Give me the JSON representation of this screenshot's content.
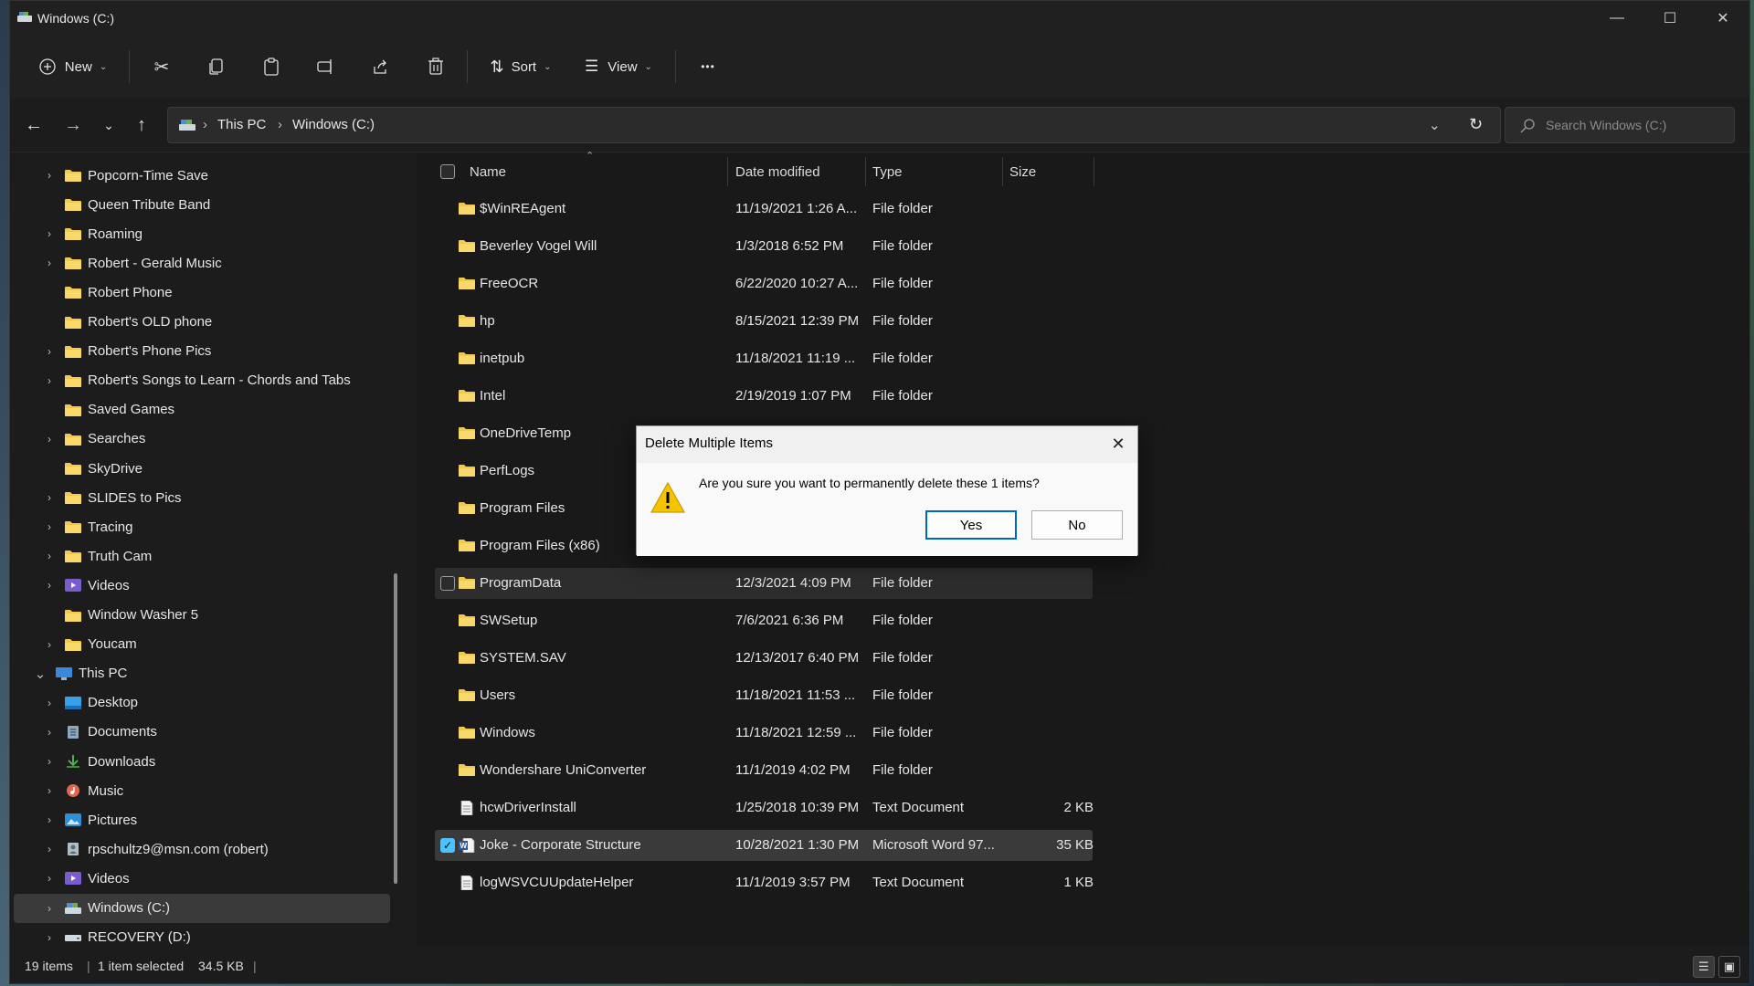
{
  "window": {
    "title": "Windows (C:)"
  },
  "toolbar": {
    "new_label": "New",
    "sort_label": "Sort",
    "view_label": "View",
    "more_label": "•••"
  },
  "address": {
    "crumbs": [
      "This PC",
      "Windows (C:)"
    ],
    "search_placeholder": "Search Windows (C:)"
  },
  "sidebar": {
    "items": [
      {
        "label": "Popcorn-Time Save",
        "expandable": true,
        "icon": "folder-icon"
      },
      {
        "label": "Queen Tribute Band",
        "expandable": false,
        "icon": "folder-icon"
      },
      {
        "label": "Roaming",
        "expandable": true,
        "icon": "folder-icon"
      },
      {
        "label": "Robert - Gerald Music",
        "expandable": true,
        "icon": "folder-icon"
      },
      {
        "label": "Robert Phone",
        "expandable": false,
        "icon": "folder-icon"
      },
      {
        "label": "Robert's OLD phone",
        "expandable": false,
        "icon": "folder-icon"
      },
      {
        "label": "Robert's Phone Pics",
        "expandable": true,
        "icon": "folder-icon"
      },
      {
        "label": "Robert's Songs to Learn - Chords and Tabs",
        "expandable": true,
        "icon": "folder-icon"
      },
      {
        "label": "Saved Games",
        "expandable": false,
        "icon": "folder-icon"
      },
      {
        "label": "Searches",
        "expandable": true,
        "icon": "folder-icon"
      },
      {
        "label": "SkyDrive",
        "expandable": false,
        "icon": "folder-icon"
      },
      {
        "label": "SLIDES to Pics",
        "expandable": true,
        "icon": "folder-icon"
      },
      {
        "label": "Tracing",
        "expandable": true,
        "icon": "folder-icon"
      },
      {
        "label": "Truth Cam",
        "expandable": true,
        "icon": "folder-icon"
      },
      {
        "label": "Videos",
        "expandable": true,
        "icon": "videos-icon"
      },
      {
        "label": "Window Washer 5",
        "expandable": false,
        "icon": "folder-icon"
      },
      {
        "label": "Youcam",
        "expandable": true,
        "icon": "folder-icon"
      },
      {
        "label": "This PC",
        "expandable": true,
        "expanded": true,
        "icon": "pc-icon"
      },
      {
        "label": "Desktop",
        "expandable": true,
        "icon": "desktop-icon"
      },
      {
        "label": "Documents",
        "expandable": true,
        "icon": "documents-icon"
      },
      {
        "label": "Downloads",
        "expandable": true,
        "icon": "downloads-icon"
      },
      {
        "label": "Music",
        "expandable": true,
        "icon": "music-icon"
      },
      {
        "label": "Pictures",
        "expandable": true,
        "icon": "pictures-icon"
      },
      {
        "label": "rpschultz9@msn.com (robert)",
        "expandable": true,
        "icon": "user-folder-icon"
      },
      {
        "label": "Videos",
        "expandable": true,
        "icon": "videos-icon"
      },
      {
        "label": "Windows (C:)",
        "expandable": true,
        "selected": true,
        "icon": "drive-c-icon"
      },
      {
        "label": "RECOVERY (D:)",
        "expandable": true,
        "icon": "drive-icon"
      }
    ]
  },
  "columns": {
    "name": "Name",
    "date": "Date modified",
    "type": "Type",
    "size": "Size"
  },
  "files": [
    {
      "name": "$WinREAgent",
      "date": "11/19/2021 1:26 A...",
      "type": "File folder",
      "size": "",
      "kind": "folder"
    },
    {
      "name": "Beverley Vogel Will",
      "date": "1/3/2018 6:52 PM",
      "type": "File folder",
      "size": "",
      "kind": "folder"
    },
    {
      "name": "FreeOCR",
      "date": "6/22/2020 10:27 A...",
      "type": "File folder",
      "size": "",
      "kind": "folder"
    },
    {
      "name": "hp",
      "date": "8/15/2021 12:39 PM",
      "type": "File folder",
      "size": "",
      "kind": "folder"
    },
    {
      "name": "inetpub",
      "date": "11/18/2021 11:19 ...",
      "type": "File folder",
      "size": "",
      "kind": "folder"
    },
    {
      "name": "Intel",
      "date": "2/19/2019 1:07 PM",
      "type": "File folder",
      "size": "",
      "kind": "folder"
    },
    {
      "name": "OneDriveTemp",
      "date": "",
      "type": "",
      "size": "",
      "kind": "folder"
    },
    {
      "name": "PerfLogs",
      "date": "",
      "type": "",
      "size": "",
      "kind": "folder"
    },
    {
      "name": "Program Files",
      "date": "",
      "type": "",
      "size": "",
      "kind": "folder"
    },
    {
      "name": "Program Files (x86)",
      "date": "",
      "type": "",
      "size": "",
      "kind": "folder"
    },
    {
      "name": "ProgramData",
      "date": "12/3/2021 4:09 PM",
      "type": "File folder",
      "size": "",
      "kind": "folder",
      "hover": true
    },
    {
      "name": "SWSetup",
      "date": "7/6/2021 6:36 PM",
      "type": "File folder",
      "size": "",
      "kind": "folder"
    },
    {
      "name": "SYSTEM.SAV",
      "date": "12/13/2017 6:40 PM",
      "type": "File folder",
      "size": "",
      "kind": "folder"
    },
    {
      "name": "Users",
      "date": "11/18/2021 11:53 ...",
      "type": "File folder",
      "size": "",
      "kind": "folder"
    },
    {
      "name": "Windows",
      "date": "11/18/2021 12:59 ...",
      "type": "File folder",
      "size": "",
      "kind": "folder"
    },
    {
      "name": "Wondershare UniConverter",
      "date": "11/1/2019 4:02 PM",
      "type": "File folder",
      "size": "",
      "kind": "folder"
    },
    {
      "name": "hcwDriverInstall",
      "date": "1/25/2018 10:39 PM",
      "type": "Text Document",
      "size": "2 KB",
      "kind": "text"
    },
    {
      "name": "Joke - Corporate Structure",
      "date": "10/28/2021 1:30 PM",
      "type": "Microsoft Word 97...",
      "size": "35 KB",
      "kind": "word",
      "selected": true
    },
    {
      "name": "logWSVCUUpdateHelper",
      "date": "11/1/2019 3:57 PM",
      "type": "Text Document",
      "size": "1 KB",
      "kind": "text"
    }
  ],
  "status": {
    "count": "19 items",
    "selection": "1 item selected",
    "size": "34.5 KB"
  },
  "dialog": {
    "title": "Delete Multiple Items",
    "message": "Are you sure you want to permanently delete these 1 items?",
    "yes_label": "Yes",
    "no_label": "No"
  },
  "colors": {
    "accent": "#4cc2ff",
    "folder": "#f2c94c",
    "dialog_default_border": "#0067c0"
  }
}
